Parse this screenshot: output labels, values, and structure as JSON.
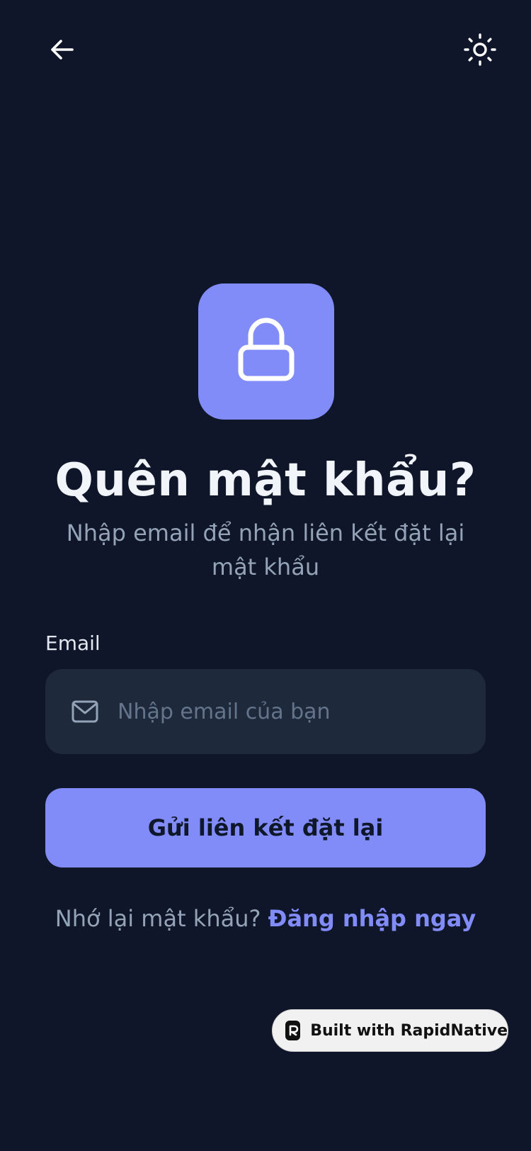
{
  "header": {
    "back_icon": "arrow-left-icon",
    "theme_icon": "sun-icon"
  },
  "hero": {
    "icon": "lock-icon",
    "accent_color": "#818cf8",
    "title": "Quên mật khẩu?",
    "subtitle": "Nhập email để nhận liên kết đặt lại mật khẩu"
  },
  "form": {
    "email_label": "Email",
    "email_icon": "mail-icon",
    "email_value": "",
    "email_placeholder": "Nhập email của bạn",
    "submit_label": "Gửi liên kết đặt lại"
  },
  "footer": {
    "remember_text": "Nhớ lại mật khẩu?",
    "signin_link": "Đăng nhập ngay"
  },
  "badge": {
    "logo_icon": "rapidnative-logo-icon",
    "label": "Built with RapidNative"
  },
  "colors": {
    "background": "#0f1629",
    "surface": "#1e293b",
    "accent": "#818cf8",
    "text_primary": "#f1f5f9",
    "text_muted": "#94a3b8"
  }
}
